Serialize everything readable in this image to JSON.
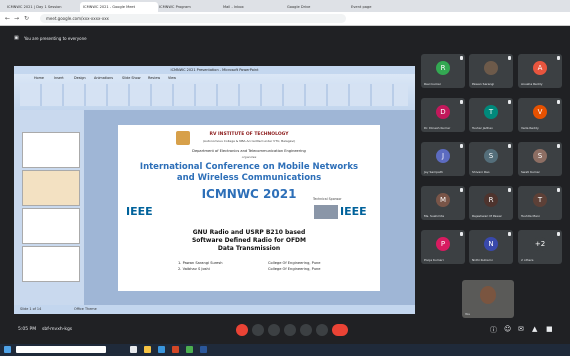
{
  "browser": {
    "tabs": [
      "ICMNWC 2021 | Day 1 Session",
      "ICMNWC 2021 - Google Meet",
      "ICMNWC Program",
      "Mail - Inbox",
      "Google Drive",
      "Event page"
    ],
    "url": "meet.google.com/xxx-xxxx-xxx"
  },
  "meet": {
    "presenter_label": "You are presenting to everyone",
    "time": "5:05 PM",
    "meeting_code": "sbf-mvxh-kgs"
  },
  "ppt": {
    "title": "ICMNWC 2021 Presentation - Microsoft PowerPoint",
    "ribbon_tabs": [
      "Home",
      "Insert",
      "Design",
      "Animations",
      "Slide Show",
      "Review",
      "View"
    ],
    "status_left": "Slide 1 of 14",
    "status_right": "Office Theme"
  },
  "slide": {
    "institute": "RV INSTITUTE OF TECHNOLOGY",
    "affiliation": "(Autonomous College & NBA Accredited under VTU, Belagavi)",
    "dept": "Department of Electronics and Telecommunication Engineering",
    "organizes": "organizes",
    "conf_line1": "International Conference on Mobile Networks",
    "conf_line2": "and Wireless Communications",
    "conf_short": "ICMNWC 2021",
    "ieee_left": "IEEE",
    "ieee_right": "IEEE",
    "tech_sponsor": "Technical Sponsor",
    "paper_title1": "GNU Radio and USRP B210 based",
    "paper_title2": "Software Defined Radio for OFDM",
    "paper_title3": "Data Transmission",
    "author1": "1. Pawan Sarangi Suresh",
    "author1_inst": "College Of Engineering, Pune",
    "author2": "2. Vaibhav S Joshi",
    "author2_inst": "College Of Engineering, Pune"
  },
  "participants": [
    {
      "name": "Ravi kumar",
      "initial": "R",
      "color": "#33a852"
    },
    {
      "name": "Pawan Sarangi",
      "initial": "",
      "color": "#6d5a4a"
    },
    {
      "name": "Anusha Reddy",
      "initial": "A",
      "color": "#e8553e"
    },
    {
      "name": "Dr. Dinesh Kumar",
      "initial": "D",
      "color": "#c2185b"
    },
    {
      "name": "Tushar Jadhav",
      "initial": "T",
      "color": "#00897b"
    },
    {
      "name": "Veda Reddy",
      "initial": "V",
      "color": "#e65100"
    },
    {
      "name": "Jay Sampath",
      "initial": "J",
      "color": "#5c6bc0"
    },
    {
      "name": "Shivani Rao",
      "initial": "S",
      "color": "#546e7a"
    },
    {
      "name": "Swati Kumar",
      "initial": "S",
      "color": "#8d6e63"
    },
    {
      "name": "Ms. Sushmita",
      "initial": "M",
      "color": "#795548"
    },
    {
      "name": "Rajeshwari M Pawar",
      "initial": "R",
      "color": "#4e342e"
    },
    {
      "name": "Tushita Mani",
      "initial": "T",
      "color": "#5d4037"
    },
    {
      "name": "Pooja Kumari",
      "initial": "P",
      "color": "#d81b60"
    },
    {
      "name": "Nidhi Kulkarni",
      "initial": "N",
      "color": "#3949ab"
    },
    {
      "name": "2 others",
      "initial": "+2",
      "color": "#3c4043"
    }
  ],
  "self_view_label": "You",
  "colors": {
    "meet_bg": "#202124",
    "leave_red": "#ea4335"
  }
}
